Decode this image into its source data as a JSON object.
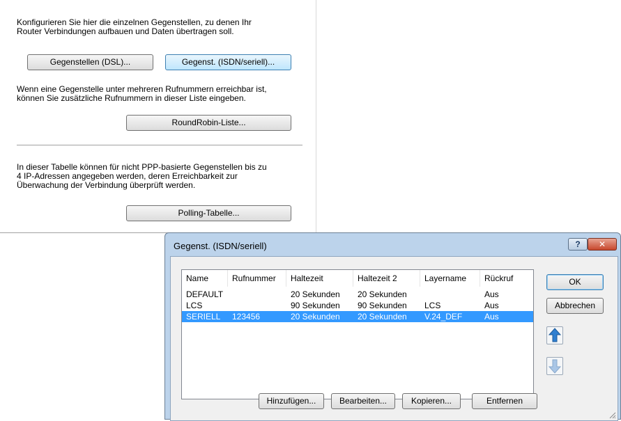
{
  "background": {
    "intro_line1": "Konfigurieren Sie hier die einzelnen Gegenstellen, zu denen Ihr",
    "intro_line2": "Router Verbindungen aufbauen und Daten übertragen soll.",
    "btn_dsl": "Gegenstellen (DSL)...",
    "btn_isdn": "Gegenst. (ISDN/seriell)...",
    "rr_line1": "Wenn eine Gegenstelle unter mehreren Rufnummern erreichbar ist,",
    "rr_line2": "können Sie zusätzliche Rufnummern in dieser Liste eingeben.",
    "btn_roundrobin": "RoundRobin-Liste...",
    "poll_line1": "In dieser Tabelle können für nicht PPP-basierte Gegenstellen bis zu",
    "poll_line2": "4 IP-Adressen angegeben werden, deren Erreichbarkeit zur",
    "poll_line3": "Überwachung der Verbindung überprüft werden.",
    "btn_polling": "Polling-Tabelle..."
  },
  "dialog": {
    "title": "Gegenst. (ISDN/seriell)",
    "help_glyph": "?",
    "close_glyph": "✕",
    "columns": [
      "Name",
      "Rufnummer",
      "Haltezeit",
      "Haltezeit 2",
      "Layername",
      "Rückruf"
    ],
    "rows": [
      [
        "DEFAULT",
        "",
        "20 Sekunden",
        "20 Sekunden",
        "",
        "Aus"
      ],
      [
        "LCS",
        "",
        "90 Sekunden",
        "90 Sekunden",
        "LCS",
        "Aus"
      ],
      [
        "SERIELL",
        "123456",
        "20 Sekunden",
        "20 Sekunden",
        "V.24_DEF",
        "Aus"
      ]
    ],
    "selected_row": 2,
    "btn_ok": "OK",
    "btn_cancel": "Abbrechen",
    "btn_add": "Hinzufügen...",
    "btn_edit": "Bearbeiten...",
    "btn_copy": "Kopieren...",
    "btn_remove": "Entfernen"
  },
  "colors": {
    "selection": "#3399ff",
    "arrow_active": "#2f7fd0",
    "arrow_inactive": "#a9c6e6"
  }
}
